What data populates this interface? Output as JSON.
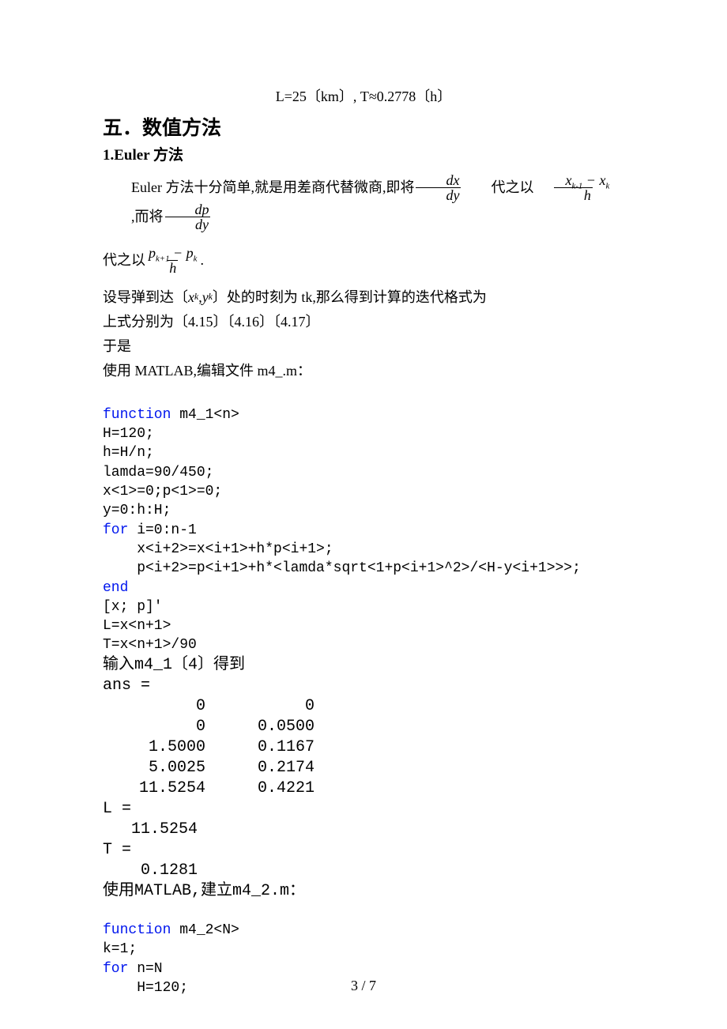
{
  "topline": "L=25〔km〕, T≈0.2778〔h〕",
  "heading_main": "五．数值方法",
  "heading_sub": "1.Euler 方法",
  "intro_part1": "Euler 方法十分简单,就是用差商代替微商,即将",
  "frac_dxdy_num": "dx",
  "frac_dxdy_den": "dy",
  "intro_part2": "代之以",
  "frac_xk_num_a": "x",
  "frac_xk_sub_a": "k-1",
  "frac_xk_mid": " − ",
  "frac_xk_num_b": "x",
  "frac_xk_sub_b": "k",
  "frac_xk_den": "h",
  "intro_part3": ",而将",
  "frac_dpdy_num": "dp",
  "frac_dpdy_den": "dy",
  "line2_part1": "代之以",
  "frac_pk_num_a": "p",
  "frac_pk_sub_a": "k+1",
  "frac_pk_mid": " − ",
  "frac_pk_num_b": "p",
  "frac_pk_sub_b": "k",
  "frac_pk_den": "h",
  "line2_part2": ".",
  "line3_a": "设导弹到达〔",
  "xk_x": "x",
  "xk_xsub": "k",
  "xk_comma": ", ",
  "xk_y": "y",
  "xk_ysub": "k",
  "line3_b": "〕处的时刻为 tk,那么得到计算的迭代格式为",
  "line4": "上式分别为〔4.15〕〔4.16〕〔4.17〕",
  "line5": "于是",
  "line6": "使用 MATLAB,编辑文件 m4_.m：",
  "code1": {
    "l1_kw": "function",
    "l1_rest": " m4_1<n>",
    "l2": "H=120;",
    "l3": "h=H/n;",
    "l4": "lamda=90/450;",
    "l5": "x<1>=0;p<1>=0;",
    "l6": "y=0:h:H;",
    "l7_kw": "for",
    "l7_rest": " i=0:n-1",
    "l8": "    x<i+2>=x<i+1>+h*p<i+1>;",
    "l9": "    p<i+2>=p<i+1>+h*<lamda*sqrt<1+p<i+1>^2>/<H-y<i+1>>>;",
    "l10_kw": "end",
    "l11": "[x; p]'",
    "l12": "L=x<n+1>",
    "l13": "T=x<n+1>/90"
  },
  "run_text": "输入m4_1〔4〕得到",
  "out_ans": "ans =",
  "out_rows": [
    {
      "a": "0",
      "b": "0"
    },
    {
      "a": "0",
      "b": "0.0500"
    },
    {
      "a": "1.5000",
      "b": "0.1167"
    },
    {
      "a": "5.0025",
      "b": "0.2174"
    },
    {
      "a": "11.5254",
      "b": "0.4221"
    }
  ],
  "out_L_label": "L =",
  "out_L_val": "   11.5254",
  "out_T_label": "T =",
  "out_T_val": "    0.1281",
  "line7": "使用MATLAB,建立m4_2.m：",
  "code2": {
    "l1_kw": "function",
    "l1_rest": " m4_2<N>",
    "l2": "k=1;",
    "l3_kw": "for",
    "l3_rest": " n=N",
    "l4": "    H=120;"
  },
  "page_number": "3 / 7"
}
